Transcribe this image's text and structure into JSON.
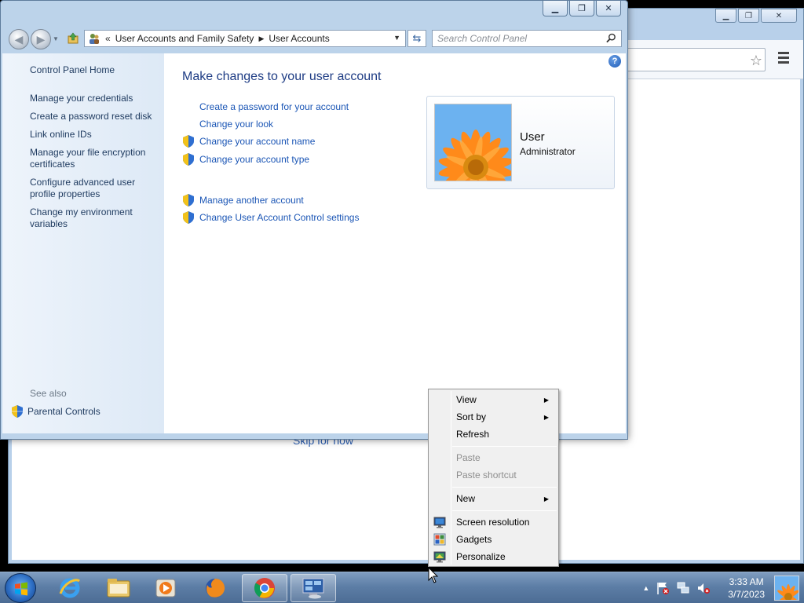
{
  "control_panel": {
    "breadcrumb": {
      "overflow": "«",
      "segments": [
        "User Accounts and Family Safety",
        "User Accounts"
      ]
    },
    "search_placeholder": "Search Control Panel",
    "left_nav": {
      "home": "Control Panel Home",
      "items": [
        "Manage your credentials",
        "Create a password reset disk",
        "Link online IDs",
        "Manage your file encryption certificates",
        "Configure advanced user profile properties",
        "Change my environment variables"
      ],
      "see_also_label": "See also",
      "see_also_items": [
        "Parental Controls"
      ]
    },
    "main": {
      "title": "Make changes to your user account",
      "tasks": [
        "Create a password for your account",
        "Change your look",
        "Change your account name",
        "Change your account type"
      ],
      "other_tasks": [
        "Manage another account",
        "Change User Account Control settings"
      ]
    },
    "user_tile": {
      "name": "User",
      "account_type": "Administrator"
    }
  },
  "background_browser": {
    "partial_link_text": "Skip for now"
  },
  "context_menu": {
    "items": [
      {
        "label": "View",
        "submenu": true,
        "enabled": true
      },
      {
        "label": "Sort by",
        "submenu": true,
        "enabled": true
      },
      {
        "label": "Refresh",
        "submenu": false,
        "enabled": true
      },
      {
        "label": "Paste",
        "submenu": false,
        "enabled": false
      },
      {
        "label": "Paste shortcut",
        "submenu": false,
        "enabled": false
      },
      {
        "label": "New",
        "submenu": true,
        "enabled": true
      },
      {
        "label": "Screen resolution",
        "icon": "screen-resolution-icon",
        "enabled": true
      },
      {
        "label": "Gadgets",
        "icon": "gadgets-icon",
        "enabled": true
      },
      {
        "label": "Personalize",
        "icon": "personalize-icon",
        "enabled": true
      }
    ]
  },
  "taskbar": {
    "apps": [
      "internet-explorer",
      "windows-explorer",
      "media-player",
      "firefox",
      "chrome",
      "control-panel"
    ],
    "clock": {
      "time": "3:33 AM",
      "date": "3/7/2023"
    }
  },
  "colors": {
    "link_blue": "#1a55b5",
    "title_blue": "#1e3c84",
    "taskbar": "#5d7ea6"
  }
}
